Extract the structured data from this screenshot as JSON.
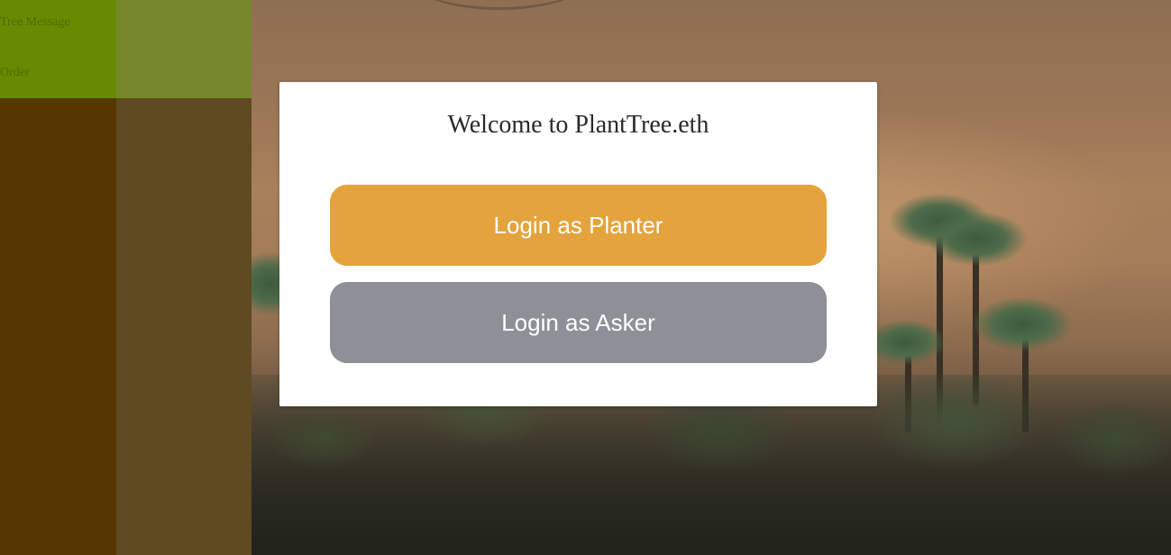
{
  "sidebar": {
    "items": [
      {
        "label": "Tree Message"
      },
      {
        "label": "Order"
      }
    ]
  },
  "modal": {
    "title": "Welcome to PlantTree.eth",
    "buttons": {
      "planter_label": "Login as Planter",
      "asker_label": "Login as Asker"
    }
  },
  "colors": {
    "planter_button": "#e5a33d",
    "asker_button": "#8e9097",
    "sidebar_menu": "#678a00",
    "sidebar_body": "#553800"
  }
}
